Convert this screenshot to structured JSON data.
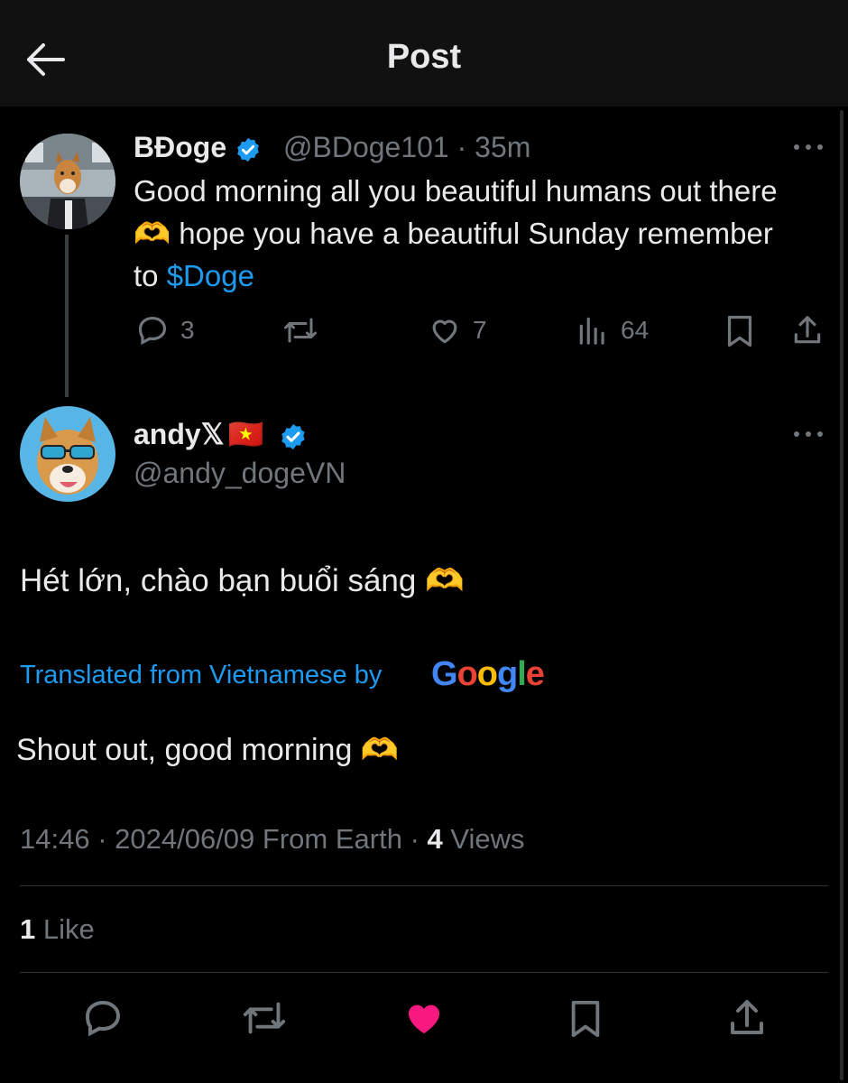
{
  "header": {
    "title": "Post"
  },
  "parent_post": {
    "author_name": "BĐoge",
    "handle": "@BDoge101",
    "time": "35m",
    "text_before": "Good morning all you beautiful humans out there 🫶 hope you have a beautiful Sunday remember to ",
    "cashtag": "$Doge",
    "replies": "3",
    "likes": "7",
    "views": "64"
  },
  "main_post": {
    "author_name": "andy𝕏",
    "flag": "🇻🇳",
    "handle": "@andy_dogeVN",
    "text": "Hét lớn, chào bạn buổi sáng 🫶",
    "translated_label": "Translated from Vietnamese by",
    "translation": "Shout out, good morning 🫶",
    "time": "14:46",
    "date": "2024/06/09",
    "source": "From Earth",
    "views_count": "4",
    "views_label": "Views",
    "likes_count": "1",
    "likes_label": "Like"
  },
  "colors": {
    "accent": "#1d9bf0",
    "like_active": "#f91880",
    "muted": "#71767b"
  },
  "icons": [
    "back-arrow-icon",
    "verified-icon",
    "more-icon",
    "reply-icon",
    "retweet-icon",
    "like-icon",
    "views-icon",
    "bookmark-icon",
    "share-icon"
  ]
}
